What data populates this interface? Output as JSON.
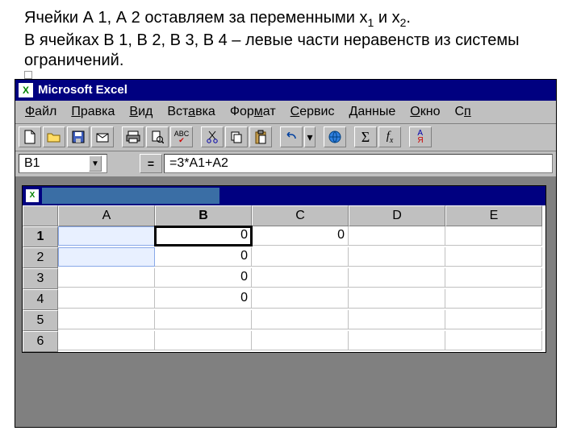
{
  "slide": {
    "text_html": "Ячейки А 1, А 2 оставляем за переменными х<sub>1</sub> и х<sub>2</sub>.<br>В ячейках В 1, В 2, В 3, В 4 – левые части неравенств из системы ограничений."
  },
  "titlebar": {
    "title": "Microsoft Excel"
  },
  "menus": [
    {
      "key": "Ф",
      "label": "айл"
    },
    {
      "key": "П",
      "label": "равка"
    },
    {
      "key": "В",
      "label": "ид"
    },
    {
      "key": "",
      "label": "Вставка",
      "raw": true,
      "u": 4
    },
    {
      "key": "",
      "label": "Формат",
      "raw": true,
      "u": 3
    },
    {
      "key": "С",
      "label": "ервис"
    },
    {
      "key": "Д",
      "label": "анные"
    },
    {
      "key": "О",
      "label": "кно"
    },
    {
      "key": "",
      "label": "Сп",
      "raw": true,
      "u": 1
    }
  ],
  "namebox": "B1",
  "formula": "=3*A1+A2",
  "columns": [
    "A",
    "B",
    "C",
    "D",
    "E"
  ],
  "rows": [
    "1",
    "2",
    "3",
    "4",
    "5",
    "6"
  ],
  "cells": {
    "B1": "0",
    "C1": "0",
    "B2": "0",
    "B3": "0",
    "B4": "0"
  },
  "active_cell": "B1",
  "highlighted": [
    "A1",
    "A2"
  ],
  "bold_col": "B",
  "bold_row": "1"
}
